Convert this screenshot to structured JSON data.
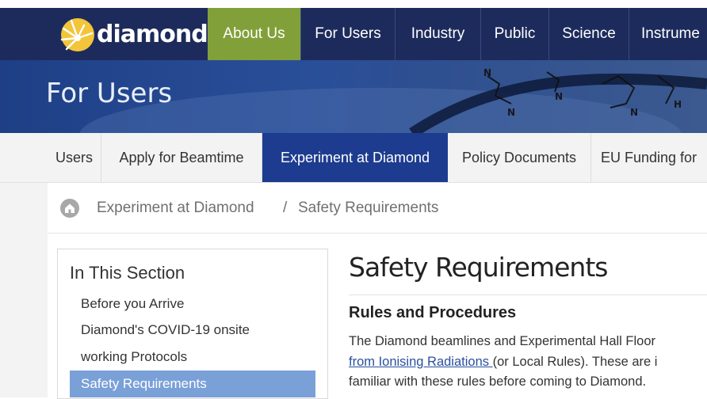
{
  "brand": {
    "name": "diamond"
  },
  "nav": {
    "items": [
      {
        "label": "About Us",
        "active": true
      },
      {
        "label": "For Users"
      },
      {
        "label": "Industry"
      },
      {
        "label": "Public"
      },
      {
        "label": "Science"
      },
      {
        "label": "Instrume"
      }
    ]
  },
  "banner": {
    "title": "For Users"
  },
  "subnav": {
    "items": [
      {
        "label": "Users"
      },
      {
        "label": "Apply for Beamtime"
      },
      {
        "label": "Experiment at Diamond",
        "active": true
      },
      {
        "label": "Policy Documents"
      },
      {
        "label": "EU Funding for"
      }
    ]
  },
  "breadcrumb": {
    "items": [
      "Experiment at Diamond",
      "Safety Requirements"
    ],
    "separator": "/"
  },
  "sidebar": {
    "title": "In This Section",
    "links": [
      "Before you Arrive",
      "Diamond's COVID-19 onsite",
      "working Protocols",
      "Safety Requirements"
    ]
  },
  "main": {
    "title": "Safety Requirements",
    "section_heading": "Rules and Procedures",
    "para1": "The Diamond beamlines and Experimental Hall Floor",
    "para2_link": "from Ionising Radiations ",
    "para2_rest": "(or Local Rules). These are i",
    "para3": "familiar with these rules before coming to Diamond."
  },
  "colors": {
    "nav_bg": "#1d2b5c",
    "nav_active": "#82a03a",
    "subnav_active": "#1d3c8f",
    "sidebar_active": "#7aa0d8",
    "link": "#2a4fa0"
  }
}
